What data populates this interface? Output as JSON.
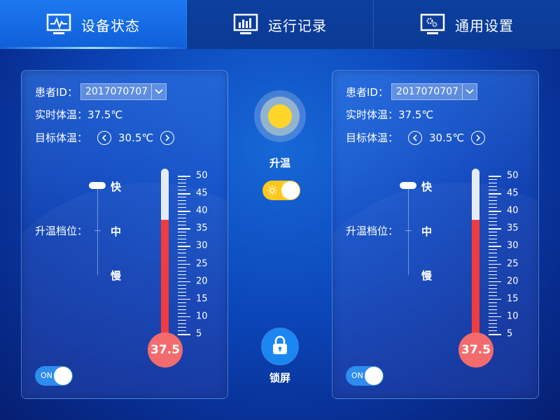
{
  "nav": {
    "tabs": [
      {
        "label": "设备状态",
        "icon": "monitor-pulse-icon",
        "active": true
      },
      {
        "label": "运行记录",
        "icon": "monitor-bar-chart-icon",
        "active": false
      },
      {
        "label": "通用设置",
        "icon": "monitor-gear-icon",
        "active": false
      }
    ]
  },
  "panels": [
    {
      "patient_label": "患者ID：",
      "patient_id": "2017070707",
      "current_temp_label": "实时体温：",
      "current_temp": "37.5℃",
      "target_temp_label": "目标体温：",
      "target_temp": "30.5℃",
      "speed_label": "升温档位：",
      "speed_options": [
        "快",
        "中",
        "慢"
      ],
      "speed_selected": "快",
      "thermometer_value": "37.5",
      "thermometer_level": 37.5,
      "scale_labels": [
        "50",
        "45",
        "40",
        "35",
        "30",
        "25",
        "20",
        "15",
        "10",
        "5"
      ],
      "scale_min": 5,
      "scale_max": 50,
      "power_toggle": "ON"
    },
    {
      "patient_label": "患者ID：",
      "patient_id": "2017070707",
      "current_temp_label": "实时体温：",
      "current_temp": "37.5℃",
      "target_temp_label": "目标体温：",
      "target_temp": "30.5℃",
      "speed_label": "升温档位：",
      "speed_options": [
        "快",
        "中",
        "慢"
      ],
      "speed_selected": "快",
      "thermometer_value": "37.5",
      "thermometer_level": 37.5,
      "scale_labels": [
        "50",
        "45",
        "40",
        "35",
        "30",
        "25",
        "20",
        "15",
        "10",
        "5"
      ],
      "scale_min": 5,
      "scale_max": 50,
      "power_toggle": "ON"
    }
  ],
  "center": {
    "heat_label": "升温",
    "heat_icon": "sun-icon",
    "lock_label": "锁屏",
    "lock_icon": "lock-icon"
  },
  "colors": {
    "accent": "#1c78f0",
    "mercury": "#f23b3d",
    "bulb": "#f46b6d",
    "heat_toggle": "#ffc81e",
    "toggle_on": "#2d8cf0"
  }
}
